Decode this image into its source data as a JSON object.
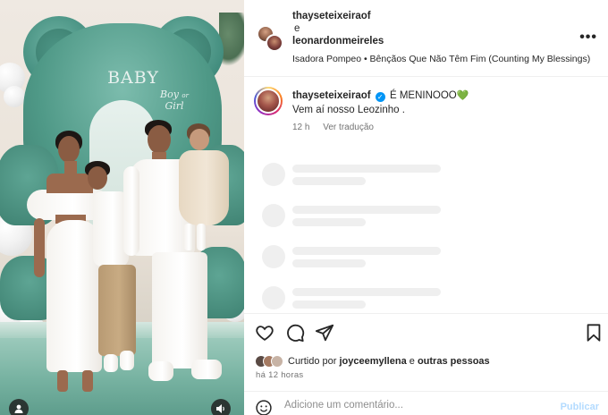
{
  "header": {
    "user1": "thayseteixeiraof",
    "connector": "e",
    "user2": "leonardonmeireles",
    "audio": "Isadora Pompeo • Bênçãos Que Não Têm Fim (Counting My Blessings)",
    "more_icon": "more-horizontal-icon"
  },
  "photo": {
    "sign_title": "BABY",
    "sign_sub1": "Boy",
    "sign_sub2": "or",
    "sign_sub3": "Girl"
  },
  "caption": {
    "username": "thayseteixeiraof",
    "text": "É MENINOOO",
    "emoji": "💚",
    "line2": "Vem aí nosso Leozinho .",
    "age": "12 h",
    "translate": "Ver tradução"
  },
  "actions": {
    "icons": [
      "heart-icon",
      "comment-icon",
      "share-icon",
      "bookmark-icon"
    ],
    "liked_by_prefix": "Curtido por",
    "liked_by_user": "joyceemyllena",
    "liked_by_suffix": "e",
    "liked_by_others": "outras pessoas",
    "time": "há 12 horas"
  },
  "comment": {
    "placeholder": "Adicione um comentário...",
    "publish": "Publicar"
  }
}
